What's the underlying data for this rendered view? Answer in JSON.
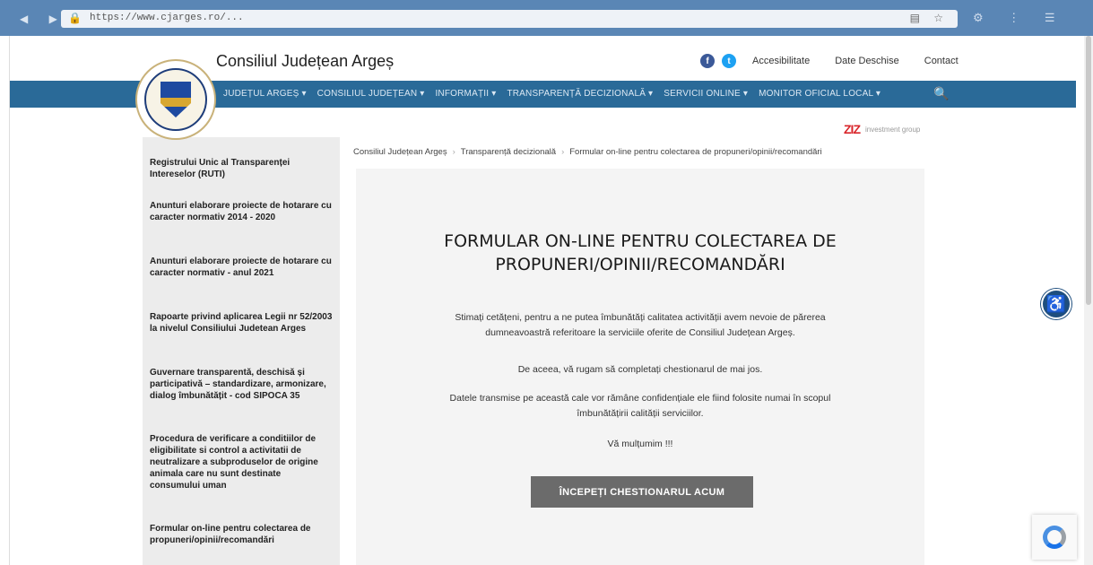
{
  "browser": {
    "url": "https://www.cjarges.ro/...",
    "nav_icons": "◀ ▶ ↻",
    "ext_icons": "⚙ ⋮ ☰",
    "reader_icons": "▤ ☆"
  },
  "header": {
    "site_title": "Consiliul Județean Argeș",
    "facebook_glyph": "f",
    "twitter_glyph": "t",
    "links": [
      "Accesibilitate",
      "Date Deschise",
      "Contact"
    ],
    "brand_mark": "ZIZ",
    "brand_text": "investment group"
  },
  "nav": {
    "items": [
      "JUDEȚUL ARGEȘ ▾",
      "CONSILIUL JUDEȚEAN ▾",
      "INFORMAȚII ▾",
      "TRANSPARENȚĂ DECIZIONALĂ ▾",
      "SERVICII ONLINE ▾",
      "MONITOR OFICIAL LOCAL ▾"
    ],
    "search_glyph": "🔍"
  },
  "sidebar": {
    "items": [
      "Registrului Unic al Transparenței Intereselor (RUTI)",
      "Anunturi elaborare proiecte de hotarare cu caracter normativ 2014 - 2020",
      "Anunturi elaborare proiecte de hotarare cu caracter normativ - anul 2021",
      "Rapoarte privind aplicarea Legii nr 52/2003 la nivelul Consiliului Judetean Arges",
      "Guvernare transparentă, deschisă și participativă – standardizare, armonizare, dialog îmbunătățit - cod SIPOCA 35",
      "Procedura de verificare a conditiilor de eligibilitate si control a activitatii de neutralizare a subproduselor de origine animala care nu sunt destinate consumului uman",
      "Formular on-line pentru colectarea de propuneri/opinii/recomandări"
    ]
  },
  "breadcrumb": {
    "items": [
      "Consiliul Județean Argeș",
      "Transparență decizională",
      "Formular on-line pentru colectarea de propuneri/opinii/recomandări"
    ],
    "separator": "›"
  },
  "main": {
    "title": "FORMULAR ON-LINE PENTRU COLECTAREA DE PROPUNERI/OPINII/RECOMANDĂRI",
    "paragraphs": [
      "Stimați cetățeni, pentru a ne putea îmbunătăți calitatea activității avem nevoie de părerea dumneavoastră referitoare la serviciile oferite de Consiliul Județean Argeș.",
      "De aceea, vă rugam să completați chestionarul de mai jos.",
      "Datele transmise pe această cale vor rămâne confidențiale ele fiind folosite numai în scopul îmbunătățirii calității serviciilor.",
      "Vă mulțumim !!!"
    ],
    "cta_label": "ÎNCEPEȚI CHESTIONARUL ACUM"
  },
  "widgets": {
    "accessibility_glyph": "♿"
  },
  "colors": {
    "nav_bg": "#2a6a98",
    "sidebar_bg": "#ececec",
    "cta_bg": "#6b6b6b"
  }
}
